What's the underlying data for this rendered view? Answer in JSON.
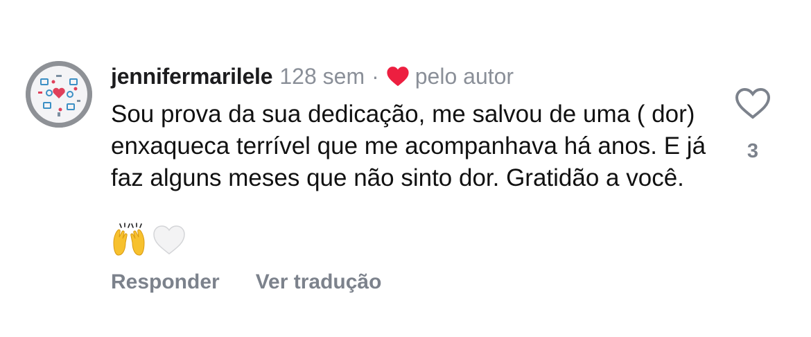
{
  "comment": {
    "username": "jennifermarilele",
    "time": "128 sem",
    "separator": "·",
    "liked_by_author_label": "pelo autor",
    "text": "Sou prova da sua dedicação, me salvou de uma ( dor) enxaqueca terrível que me acompanhava há anos. E já faz alguns meses que não sinto dor. Gratidão a você.",
    "emojis": [
      "raising-hands-emoji",
      "white-heart-emoji"
    ],
    "like_count": "3"
  },
  "actions": {
    "reply_label": "Responder",
    "translate_label": "Ver tradução"
  },
  "icons": {
    "author_heart": "heart-filled-icon",
    "like": "heart-outline-icon"
  },
  "colors": {
    "author_heart": "#ed1f40",
    "muted_text": "#8a8f98",
    "action_text": "#7c828c"
  }
}
